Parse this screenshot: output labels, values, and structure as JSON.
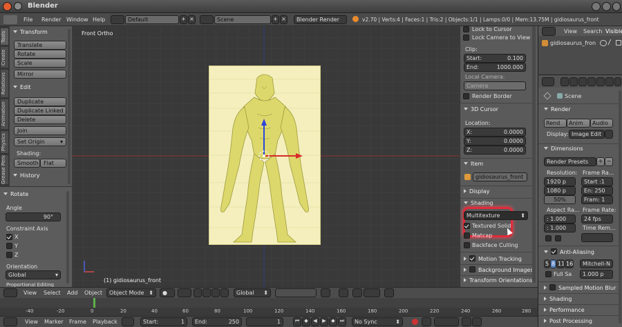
{
  "app": {
    "title": "Blender"
  },
  "menu": {
    "file": "File",
    "render": "Render",
    "window": "Window",
    "help": "Help",
    "layout": "Default",
    "scene": "Scene",
    "engine": "Blender Render",
    "stats": "v2.70 | Verts:4 | Faces:1 | Tris:2 | Objects:1/1 | Lamps:0/0 | Mem:13.75M | gidiosaurus_front"
  },
  "tabs": [
    "Tools",
    "Create",
    "Relations",
    "Animation",
    "Physics",
    "Grease Pencil"
  ],
  "tools": {
    "transform": "Transform",
    "translate": "Translate",
    "rotate": "Rotate",
    "scale": "Scale",
    "mirror": "Mirror",
    "edit": "Edit",
    "duplicate": "Duplicate",
    "duplicate_linked": "Duplicate Linked",
    "delete": "Delete",
    "join": "Join",
    "set_origin": "Set Origin",
    "shading": "Shading:",
    "smooth": "Smooth",
    "flat": "Flat",
    "history": "History"
  },
  "operator": {
    "title": "Rotate",
    "angle_label": "Angle",
    "angle_value": "90°",
    "constraint_axis": "Constraint Axis",
    "x": "X",
    "y": "Y",
    "z": "Z",
    "orientation": "Orientation",
    "orientation_value": "Global",
    "proportional": "Proportional Editing"
  },
  "viewport": {
    "label": "Front Ortho",
    "object": "(1) gidiosaurus_front"
  },
  "npanel": {
    "lock_cursor": "Lock to Cursor",
    "lock_camera": "Lock Camera to View",
    "clip": "Clip:",
    "start_label": "Start:",
    "start_value": "0.100",
    "end_label": "End:",
    "end_value": "1000.000",
    "local_camera": "Local Camera:",
    "camera": "Camera",
    "render_border": "Render Border",
    "cursor_3d": "3D Cursor",
    "location": "Location:",
    "x_label": "X:",
    "x_value": "0.0000",
    "y_label": "Y:",
    "y_value": "0.0000",
    "z_label": "Z:",
    "z_value": "0.0000",
    "item": "Item",
    "item_name": "gidiosaurus_front",
    "display": "Display",
    "shading": "Shading",
    "shading_mode": "Multitexture",
    "textured_solid": "Textured Solid",
    "matcap": "Matcap",
    "backface": "Backface Culling",
    "motion_tracking": "Motion Tracking",
    "background_images": "Background Images",
    "transform_orientations": "Transform Orientations"
  },
  "outliner": {
    "view": "View",
    "search": "Search",
    "visible": "Visible",
    "object": "gidiosaurus_fron"
  },
  "properties": {
    "scene": "Scene",
    "render": "Render",
    "rend": "Rend",
    "anim": "Anim",
    "audio": "Audio",
    "display_label": "Display:",
    "display_value": "Image Edit",
    "dimensions": "Dimensions",
    "render_presets": "Render Presets",
    "resolution": "Resolution:",
    "res_x": "1920 p",
    "res_y": "1080 p",
    "res_pct": "50%",
    "frame_range": "Frame Ra...",
    "start": "Start :1",
    "end": "En: 250",
    "frame": "Fram: 1",
    "aspect": "Aspect Ra...",
    "aspect_x": ": 1.000",
    "aspect_y": ": 1.000",
    "frame_rate": "Frame Rate:",
    "fps": "24 fps",
    "time_remap": "Time Rem...",
    "anti_aliasing": "Anti-Aliasing",
    "aa5": "5",
    "aa8": "8",
    "aa11": "11",
    "aa16": "16",
    "filter": "Mitchell-N",
    "full_sample": "Full Sa",
    "filter_size": "1.000 p",
    "sampled_motion": "Sampled Motion Blur",
    "shading_p": "Shading",
    "performance": "Performance",
    "post_processing": "Post Processing"
  },
  "header3d": {
    "view": "View",
    "select": "Select",
    "add": "Add",
    "object": "Object",
    "mode": "Object Mode",
    "orientation": "Global"
  },
  "timeline": {
    "view": "View",
    "marker": "Marker",
    "frame": "Frame",
    "playback": "Playback",
    "start_label": "Start:",
    "start_value": "1",
    "end_label": "End:",
    "end_value": "250",
    "current": "1",
    "sync": "No Sync",
    "ticks": [
      "-40",
      "-20",
      "0",
      "20",
      "40",
      "60",
      "80",
      "100",
      "120",
      "140",
      "160",
      "180",
      "200",
      "220",
      "240",
      "260",
      "280"
    ]
  },
  "colors": {
    "highlight": "#e02b3a",
    "creature": "#e0db6e",
    "plane": "#f4efbc"
  }
}
